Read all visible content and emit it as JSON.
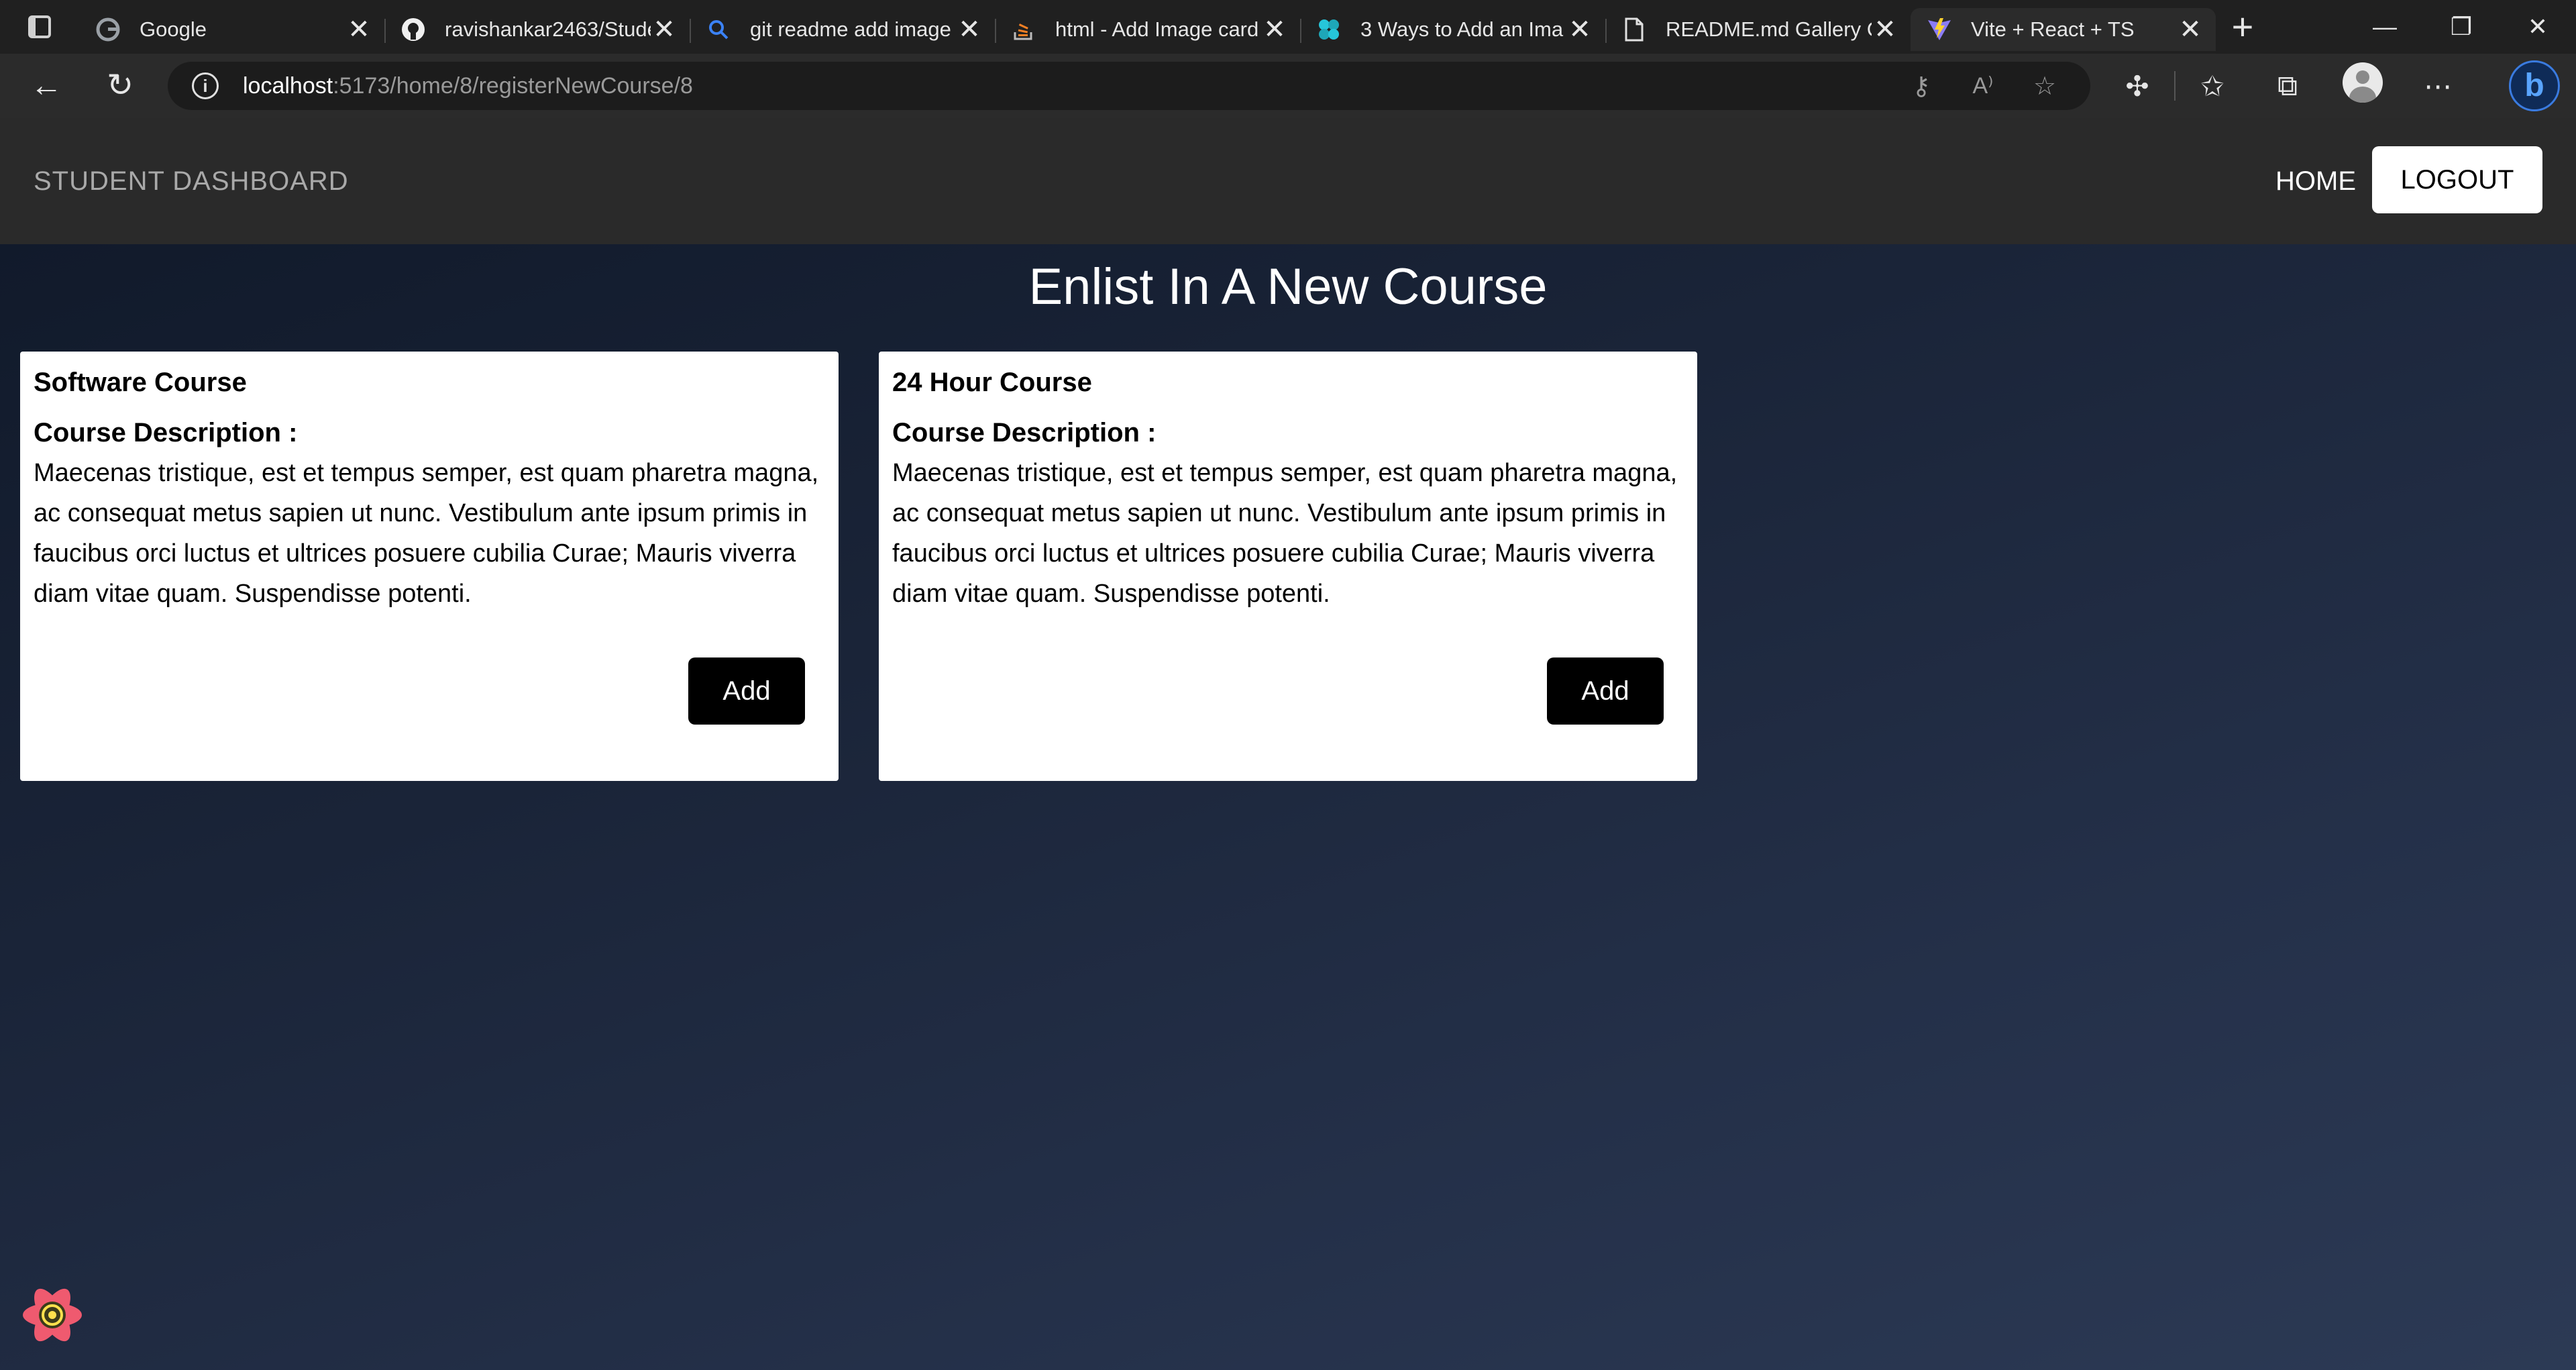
{
  "browser": {
    "tabs": [
      {
        "title": "Google",
        "favicon": "google-icon"
      },
      {
        "title": "ravishankar2463/Stude",
        "favicon": "github-icon"
      },
      {
        "title": "git readme add image",
        "favicon": "search-icon"
      },
      {
        "title": "html - Add Image card",
        "favicon": "stackoverflow-icon"
      },
      {
        "title": "3 Ways to Add an Ima",
        "favicon": "site-icon"
      },
      {
        "title": "README.md Gallery C",
        "favicon": "document-icon"
      },
      {
        "title": "Vite + React + TS",
        "favicon": "vite-icon",
        "active": true
      }
    ],
    "url_host": "localhost",
    "url_path": ":5173/home/8/registerNewCourse/8"
  },
  "navbar": {
    "brand": "STUDENT DASHBOARD",
    "home": "HOME",
    "logout": "LOGOUT"
  },
  "page": {
    "title": "Enlist In A New Course"
  },
  "courses": [
    {
      "name": "Software Course",
      "desc_label": "Course Description :",
      "description": "Maecenas tristique, est et tempus semper, est quam pharetra magna, ac consequat metus sapien ut nunc. Vestibulum ante ipsum primis in faucibus orci luctus et ultrices posuere cubilia Curae; Mauris viverra diam vitae quam. Suspendisse potenti.",
      "button": "Add"
    },
    {
      "name": "24 Hour Course",
      "desc_label": "Course Description :",
      "description": "Maecenas tristique, est et tempus semper, est quam pharetra magna, ac consequat metus sapien ut nunc. Vestibulum ante ipsum primis in faucibus orci luctus et ultrices posuere cubilia Curae; Mauris viverra diam vitae quam. Suspendisse potenti.",
      "button": "Add"
    }
  ],
  "colors": {
    "navbar_bg": "#2a2a2a",
    "card_bg": "#ffffff",
    "button_bg": "#000000",
    "accent": "#59a4ff"
  }
}
